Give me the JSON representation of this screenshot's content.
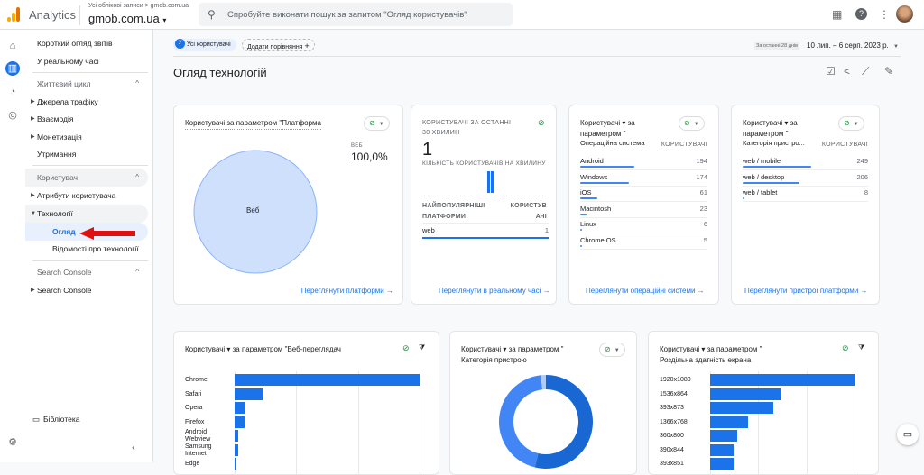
{
  "header": {
    "app": "Analytics",
    "breadcrumb": "Усі облікові записи > gmob.com.ua",
    "property": "gmob.com.ua",
    "search_placeholder": "Спробуйте виконати пошук за запитом \"Огляд користувачів\""
  },
  "colors": {
    "accent": "#1a73e8",
    "bar": "#1a73e8",
    "success": "#1e8e3e",
    "arrow": "#e01010"
  },
  "sidebar": {
    "top": [
      "Короткий огляд звітів",
      "У реальному часі"
    ],
    "lifecycle": {
      "label": "Життєвий цикл",
      "items": [
        "Джерела трафіку",
        "Взаємодія",
        "Монетизація",
        "Утримання"
      ]
    },
    "user": {
      "label": "Користувач",
      "items": [
        "Атрибути користувача",
        "Технології"
      ],
      "sub": [
        "Огляд",
        "Відомості про технології"
      ]
    },
    "search_console": {
      "label": "Search Console",
      "items": [
        "Search Console"
      ]
    },
    "library": "Бібліотека"
  },
  "filters": {
    "segment_letter": "У",
    "segment": "Усі користувачі",
    "add_compare": "Додати порівняння",
    "date_hint": "За останні 28 днів",
    "date_range": "10 лип. – 6 серп. 2023 р."
  },
  "page_title": "Огляд технологій",
  "platform_card": {
    "title": "Користувачі за параметром \"Платформа",
    "legend": "ВЕБ",
    "percent": "100,0%",
    "slice": "Веб",
    "link": "Переглянути платформи"
  },
  "realtime_card": {
    "title1": "КОРИСТУВАЧІ ЗА ОСТАННІ",
    "title2": "30 ХВИЛИН",
    "value": "1",
    "sub": "КІЛЬКІСТЬ КОРИСТУВАЧІВ НА ХВИЛИНУ",
    "col1a": "НАЙПОПУЛЯРНІШІ",
    "col1b": "ПЛАТФОРМИ",
    "col2a": "КОРИСТУВ",
    "col2b": "АЧІ",
    "rows": [
      {
        "name": "web",
        "value": "1"
      }
    ],
    "link": "Переглянути в реальному часі"
  },
  "os_card": {
    "t1": "Користувачі ▾ за",
    "t2": "параметром \"",
    "t3": "Операційна система",
    "col": "КОРИСТУВАЧІ",
    "rows": [
      {
        "name": "Android",
        "value": 194
      },
      {
        "name": "Windows",
        "value": 174
      },
      {
        "name": "iOS",
        "value": 61
      },
      {
        "name": "Macintosh",
        "value": 23
      },
      {
        "name": "Linux",
        "value": 6
      },
      {
        "name": "Chrome OS",
        "value": 5
      }
    ],
    "link": "Переглянути операційні системи"
  },
  "device_card": {
    "t1": "Користувачі ▾ за",
    "t2": "параметром \"",
    "t3": "Категорія пристро...",
    "col": "КОРИСТУВАЧІ",
    "rows": [
      {
        "name": "web / mobile",
        "value": 249
      },
      {
        "name": "web / desktop",
        "value": 206
      },
      {
        "name": "web / tablet",
        "value": 8
      }
    ],
    "link": "Переглянути пристрої платформи"
  },
  "browser_card": {
    "title": "Користувачі ▾  за параметром \"Веб-переглядач",
    "labels": [
      "Chrome",
      "Safari",
      "Opera",
      "Firefox",
      "Android Webview",
      "Samsung Internet",
      "Edge"
    ],
    "values": [
      100,
      15,
      6,
      5.5,
      2,
      2,
      1
    ]
  },
  "devcat_card": {
    "t1": "Користувачі ▾  за параметром \"",
    "t2": "Категорія пристрою",
    "values": [
      249,
      206,
      8
    ]
  },
  "screen_card": {
    "t1": "Користувачі ▾  за параметром \"",
    "t2": "Роздільна здатність екрана",
    "labels": [
      "1920x1080",
      "1536x864",
      "393x873",
      "1366x768",
      "360x800",
      "390x844",
      "393x851"
    ],
    "values": [
      100,
      49,
      44,
      26,
      19,
      16,
      16
    ]
  }
}
